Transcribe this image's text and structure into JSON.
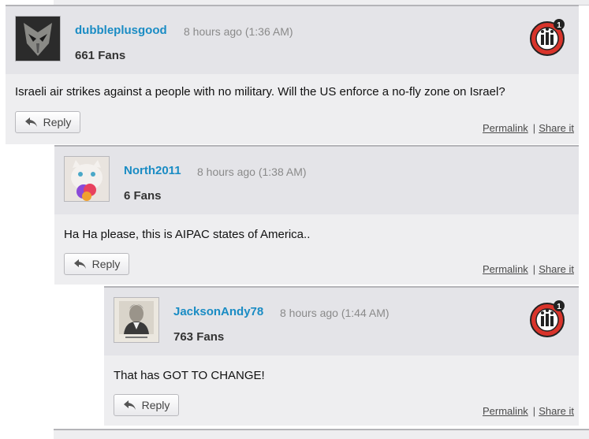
{
  "comments": [
    {
      "username": "dubbleplusgood",
      "time": "8 hours ago (1:36 AM)",
      "fans": "661 Fans",
      "text": "Israeli air strikes against a people with no military. Will the US enforce a no-fly zone on Israel?",
      "reply_label": "Reply",
      "permalink_label": "Permalink",
      "separator": "|",
      "share_label": "Share it",
      "badge_count": "1",
      "avatar_icon": "mask-avatar-icon"
    },
    {
      "username": "North2011",
      "time": "8 hours ago (1:38 AM)",
      "fans": "6 Fans",
      "text": "Ha Ha please, this is AIPAC states of America..",
      "reply_label": "Reply",
      "permalink_label": "Permalink",
      "separator": "|",
      "share_label": "Share it",
      "avatar_icon": "cat-avatar-icon"
    },
    {
      "username": "JacksonAndy78",
      "time": "8 hours ago (1:44 AM)",
      "fans": "763 Fans",
      "text": "That has GOT TO CHANGE!",
      "reply_label": "Reply",
      "permalink_label": "Permalink",
      "separator": "|",
      "share_label": "Share it",
      "badge_count": "1",
      "avatar_icon": "portrait-avatar-icon"
    }
  ],
  "colors": {
    "username": "#1a8cc4",
    "header_bg": "#e4e4e8",
    "body_bg": "#eeeef0",
    "badge_red": "#d9342b"
  }
}
